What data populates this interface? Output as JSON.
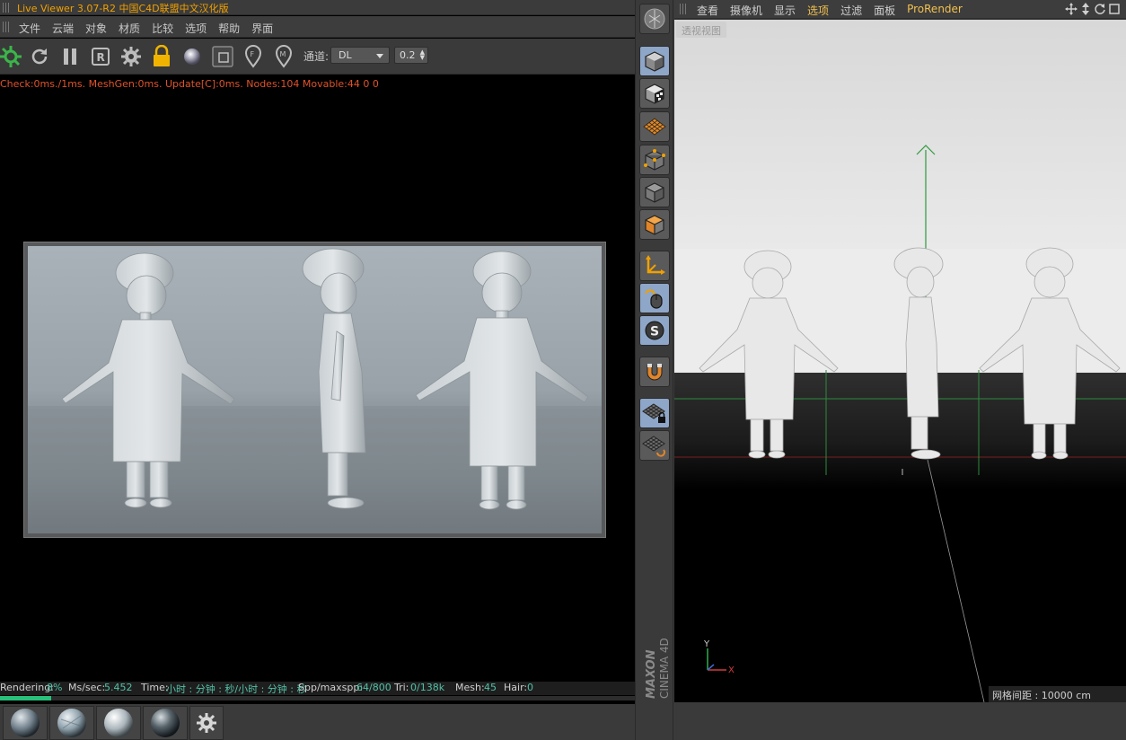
{
  "live_viewer": {
    "title": "Live Viewer 3.07-R2 中国C4D联盟中文汉化版",
    "menu": [
      "文件",
      "云端",
      "对象",
      "材质",
      "比较",
      "选项",
      "帮助",
      "界面"
    ],
    "channel_label": "通道:",
    "channel_value": "DL",
    "spin_value": "0.2",
    "status_line": "Check:0ms./1ms. MeshGen:0ms. Update[C]:0ms. Nodes:104 Movable:44  0 0",
    "info": {
      "rendering_label": "Rendering:",
      "rendering_value": "8%",
      "ms_label": "Ms/sec:",
      "ms_value": "5.452",
      "time_label": "Time:",
      "time_value": "小时 : 分钟 : 秒/小时 : 分钟 : 秒",
      "spp_label": "Spp/maxspp:",
      "spp_value": "64/800",
      "tri_label": "Tri:",
      "tri_value": "0/138k",
      "mesh_label": "Mesh:",
      "mesh_value": "45",
      "hair_label": "Hair:",
      "hair_value": "0"
    },
    "progress_percent": 8
  },
  "viewport": {
    "menu": [
      "查看",
      "摄像机",
      "显示",
      "选项",
      "过滤",
      "面板",
      "ProRender"
    ],
    "active_menu": "选项",
    "camera_label": "透视视图",
    "grid_spacing": "网格间距 : 10000 cm",
    "axis_x": "X",
    "axis_y": "Y"
  },
  "branding": {
    "maxon": "MAXON",
    "cinema": "CINEMA 4D"
  },
  "colors": {
    "accent_orange": "#f0a000",
    "status_red": "#e0522a",
    "value_teal": "#52c0a6",
    "menu_active": "#f2c14e",
    "progress_green": "#28c07a"
  }
}
